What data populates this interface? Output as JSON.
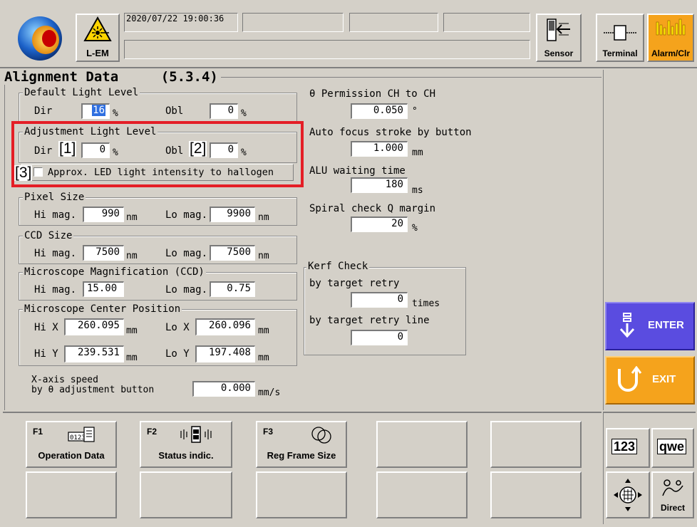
{
  "header": {
    "app_label": "L-EM",
    "datetime": "2020/07/22 19:00:36",
    "buttons": {
      "sensor": "Sensor",
      "terminal": "Terminal",
      "alarm": "Alarm/Clr"
    }
  },
  "page": {
    "title": "Alignment Data",
    "section_code": "(5.3.4)"
  },
  "default_light": {
    "label": "Default Light Level",
    "dir_label": "Dir",
    "dir_value": "16",
    "obl_label": "Obl",
    "obl_value": "0",
    "unit": "%"
  },
  "adjust_light": {
    "label": "Adjustment Light Level",
    "dir_label": "Dir",
    "dir_value": "0",
    "obl_label": "Obl",
    "obl_value": "0",
    "unit": "%",
    "approx_label": "Approx. LED light intensity to hallogen"
  },
  "pixel_size": {
    "label": "Pixel Size",
    "hi_label": "Hi mag.",
    "hi_value": "990",
    "lo_label": "Lo mag.",
    "lo_value": "9900",
    "unit": "nm"
  },
  "ccd_size": {
    "label": "CCD Size",
    "hi_label": "Hi mag.",
    "hi_value": "7500",
    "lo_label": "Lo mag.",
    "lo_value": "7500",
    "unit": "nm"
  },
  "magnification": {
    "label": "Microscope Magnification (CCD)",
    "hi_label": "Hi mag.",
    "hi_value": "15.00",
    "lo_label": "Lo mag.",
    "lo_value": "0.75"
  },
  "center": {
    "label": "Microscope Center Position",
    "hix_label": "Hi X",
    "hix_value": "260.095",
    "lox_label": "Lo X",
    "lox_value": "260.096",
    "hiy_label": "Hi Y",
    "hiy_value": "239.531",
    "loy_label": "Lo Y",
    "loy_value": "197.408",
    "unit": "mm"
  },
  "xaxis": {
    "label_line1": "X-axis speed",
    "label_line2": "by θ adjustment button",
    "value": "0.000",
    "unit": "mm/s"
  },
  "right_params": {
    "permission_label": "θ Permission CH to CH",
    "permission_value": "0.050",
    "permission_unit": "°",
    "autofocus_label": "Auto focus stroke by button",
    "autofocus_value": "1.000",
    "autofocus_unit": "mm",
    "alu_label": "ALU waiting time",
    "alu_value": "180",
    "alu_unit": "ms",
    "spiral_label": "Spiral check Q margin",
    "spiral_value": "20",
    "spiral_unit": "%"
  },
  "kerf": {
    "label": "Kerf Check",
    "retry_label": "by target retry",
    "retry_value": "0",
    "retry_unit": "times",
    "line_label": "by target retry line",
    "line_value": "0"
  },
  "side_buttons": {
    "enter": "ENTER",
    "exit": "EXIT",
    "numeric": "123",
    "alpha": "qwe",
    "direct": "Direct"
  },
  "fkeys": [
    {
      "num": "F1",
      "label": "Operation Data"
    },
    {
      "num": "F2",
      "label": "Status indic."
    },
    {
      "num": "F3",
      "label": "Reg Frame Size"
    }
  ],
  "callouts": {
    "c1": "[1]",
    "c2": "[2]",
    "c3": "[3]"
  },
  "colors": {
    "panel": "#d4d0c8",
    "enter": "#5a4ce0",
    "exit": "#f5a31c",
    "alarm": "#f5a31c",
    "highlight": "#e41e26",
    "selected_field": "#2f6fe0"
  }
}
